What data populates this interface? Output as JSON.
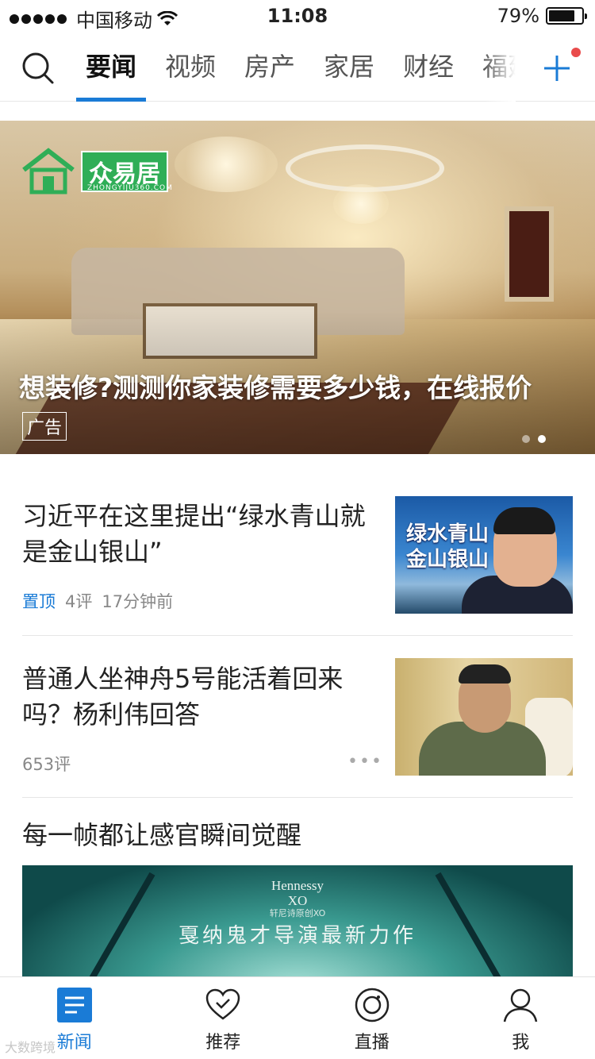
{
  "status_bar": {
    "carrier": "中国移动",
    "time": "11:08",
    "battery_percent": "79%",
    "battery_level": 0.79,
    "icons": [
      "signal-icon",
      "wifi-icon",
      "battery-icon"
    ]
  },
  "top_nav": {
    "tabs": [
      {
        "label": "要闻",
        "active": true
      },
      {
        "label": "视频",
        "active": false
      },
      {
        "label": "房产",
        "active": false
      },
      {
        "label": "家居",
        "active": false
      },
      {
        "label": "财经",
        "active": false
      },
      {
        "label": "福建",
        "active": false
      }
    ],
    "icons": {
      "search": "search-icon",
      "add": "plus-icon"
    },
    "accent_color": "#1a7bd6",
    "notification_dot_color": "#e94b4b"
  },
  "banner": {
    "logo_text": "众易居",
    "logo_subtext": "ZHONGYIJU360.COM",
    "title": "想装修?测测你家装修需要多少钱，在线报价",
    "badge": "广告",
    "slides": 2,
    "current_slide": 2
  },
  "news": [
    {
      "title": "习近平在这里提出“绿水青山就是金山银山”",
      "pinned_label": "置顶",
      "comments": "4评",
      "time": "17分钟前",
      "thumb_text_line1": "绿水青山",
      "thumb_text_line2": "金山银山"
    },
    {
      "title": "普通人坐神舟5号能活着回来吗？杨利伟回答",
      "comments": "653评",
      "more": "•••"
    }
  ],
  "video": {
    "title": "每一帧都让感官瞬间觉醒",
    "brand": "Hennessy",
    "brand_line2": "XO",
    "brand_sub": "轩尼诗原创XO",
    "caption": "戛纳鬼才导演最新力作"
  },
  "bottom_tabs": [
    {
      "label": "新闻",
      "icon": "news-icon",
      "active": true
    },
    {
      "label": "推荐",
      "icon": "heart-check-icon",
      "active": false
    },
    {
      "label": "直播",
      "icon": "live-icon",
      "active": false
    },
    {
      "label": "我",
      "icon": "user-icon",
      "active": false
    }
  ],
  "watermark": "大数跨境"
}
